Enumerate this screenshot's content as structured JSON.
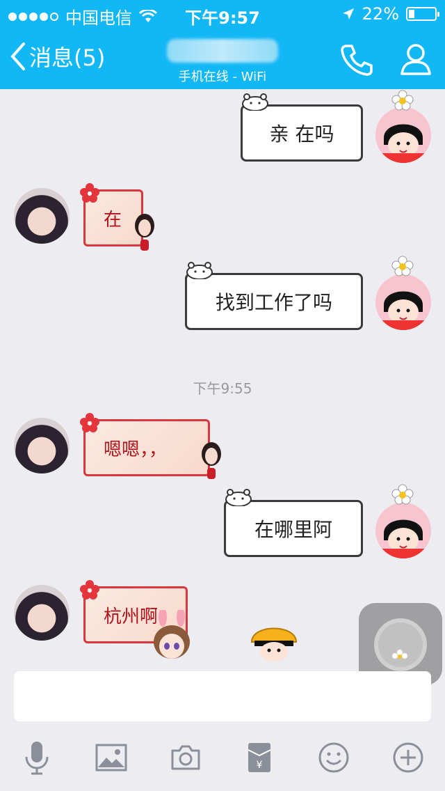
{
  "status_bar": {
    "carrier": "中国电信",
    "time": "下午9:57",
    "battery": "22%"
  },
  "nav": {
    "back_label": "消息(5)",
    "subtitle": "手机在线 - WiFi"
  },
  "messages": [
    {
      "side": "me",
      "text": "亲  在吗"
    },
    {
      "side": "other",
      "text": "在"
    },
    {
      "side": "me",
      "text": "找到工作了吗"
    },
    {
      "side": "other",
      "text": "嗯嗯，，"
    },
    {
      "side": "me",
      "text": "在哪里阿"
    },
    {
      "side": "other",
      "text": "杭州啊"
    }
  ],
  "timestamp": "下午9:55",
  "input": {
    "placeholder": ""
  },
  "toolbar": [
    "microphone-icon",
    "image-icon",
    "camera-icon",
    "red-packet-icon",
    "emoji-icon",
    "plus-icon"
  ],
  "colors": {
    "header": "#12b7f5",
    "background": "#ececf1",
    "other_bubble_border": "#d9363e"
  }
}
